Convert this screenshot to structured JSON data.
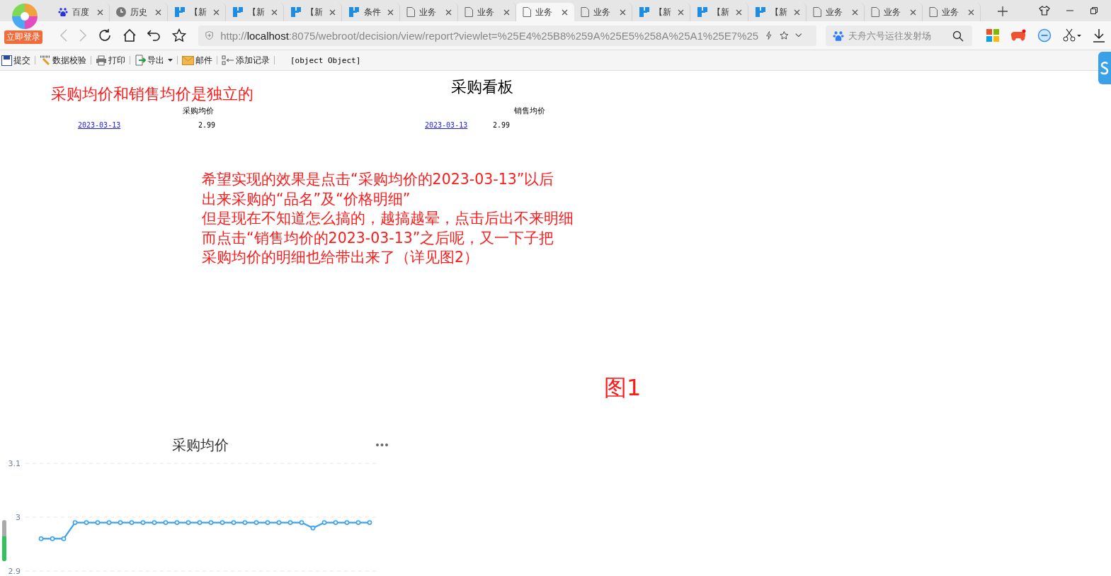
{
  "browser": {
    "login_badge": "立即登录",
    "tabs": [
      {
        "label": "百度",
        "kind": "baidu",
        "selected": false
      },
      {
        "label": "历史",
        "kind": "history",
        "selected": false
      },
      {
        "label": "【新",
        "kind": "app",
        "selected": false
      },
      {
        "label": "【新",
        "kind": "app",
        "selected": false
      },
      {
        "label": "【新",
        "kind": "app",
        "selected": false
      },
      {
        "label": "条件",
        "kind": "app",
        "selected": false
      },
      {
        "label": "业务",
        "kind": "page",
        "selected": false
      },
      {
        "label": "业务",
        "kind": "page",
        "selected": false
      },
      {
        "label": "业务",
        "kind": "page",
        "selected": true
      },
      {
        "label": "业务",
        "kind": "page",
        "selected": false
      },
      {
        "label": "【新",
        "kind": "app",
        "selected": false
      },
      {
        "label": "【新",
        "kind": "app",
        "selected": false
      },
      {
        "label": "【新",
        "kind": "app",
        "selected": false
      },
      {
        "label": "业务",
        "kind": "page",
        "selected": false
      },
      {
        "label": "业务",
        "kind": "page",
        "selected": false
      },
      {
        "label": "业务",
        "kind": "page",
        "selected": false
      }
    ],
    "address": {
      "scheme": "http://",
      "host": "localhost",
      "rest": ":8075/webroot/decision/view/report?viewlet=%25E4%25B8%259A%25E5%258A%25A1%25E7%25"
    },
    "search": {
      "placeholder": "天舟六号运往发射场"
    }
  },
  "toolbar": {
    "items": [
      {
        "label": "提交",
        "kind": "save"
      },
      {
        "label": "数据校验",
        "kind": "check"
      },
      {
        "label": "打印",
        "kind": "print"
      },
      {
        "label": "导出",
        "kind": "export"
      },
      {
        "label": "邮件",
        "kind": "mail"
      },
      {
        "label": "添加记录",
        "kind": "add"
      }
    ],
    "message": "[object Object]"
  },
  "page": {
    "note": "采购均价和销售均价是独立的",
    "title": "采购看板",
    "tables": [
      {
        "header": "采购均价",
        "rows": [
          {
            "date": "2023-03-13",
            "value": "2.99"
          }
        ]
      },
      {
        "header": "销售均价",
        "rows": [
          {
            "date": "2023-03-13",
            "value": "2.99"
          }
        ]
      }
    ],
    "annotation": [
      "希望实现的效果是点击“采购均价的2023-03-13”以后",
      "出来采购的“品名”及“价格明细”",
      "但是现在不知道怎么搞的，越搞越晕，点击后出不来明细",
      "而点击“销售均价的2023-03-13”之后呢，又一下子把",
      "采购均价的明细也给带出来了（详见图2）"
    ],
    "figure_label": "图1",
    "chart": {
      "chart_data": {
        "type": "line",
        "title": "采购均价",
        "yticks": [
          2.9,
          3,
          3.1
        ],
        "ylim": [
          2.9,
          3.1
        ],
        "series": [
          {
            "color": "#3ba1f2",
            "marker": "circle",
            "values": [
              null,
              2.96,
              2.96,
              2.96,
              2.99,
              2.99,
              2.99,
              2.99,
              2.99,
              2.99,
              2.99,
              2.99,
              2.99,
              2.99,
              2.99,
              2.99,
              2.99,
              2.99,
              2.99,
              2.99,
              2.99,
              2.99,
              2.99,
              2.99,
              2.99,
              2.98,
              2.99,
              2.99,
              2.99,
              2.99,
              2.99
            ]
          }
        ]
      }
    }
  }
}
